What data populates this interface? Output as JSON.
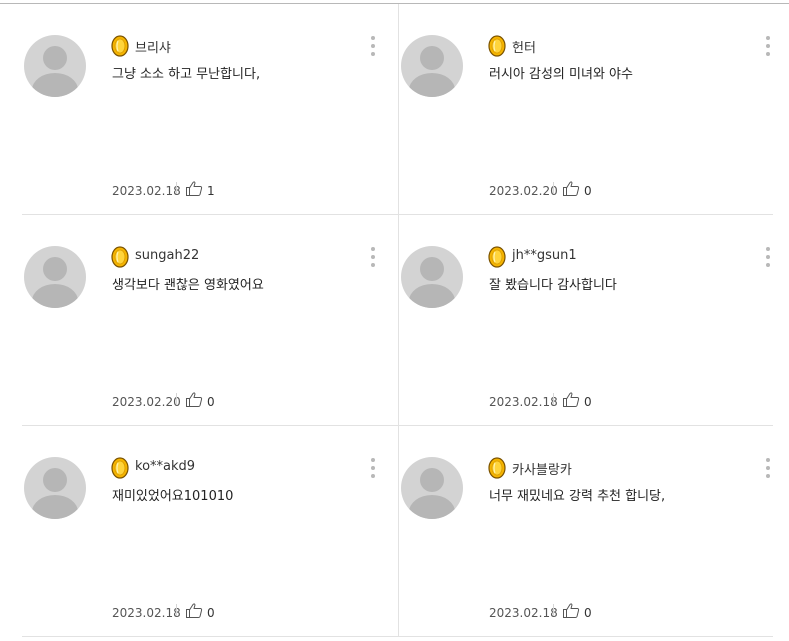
{
  "reviews": [
    {
      "nick": "브리샤",
      "comment": "그냥 소소 하고 무난합니다,",
      "date": "2023.02.18",
      "likes": "1"
    },
    {
      "nick": "헌터",
      "comment": "러시아 감성의 미녀와 야수",
      "date": "2023.02.20",
      "likes": "0"
    },
    {
      "nick": "sungah22",
      "comment": "생각보다 괜찮은 영화였어요",
      "date": "2023.02.20",
      "likes": "0"
    },
    {
      "nick": "jh**gsun1",
      "comment": "잘 봤습니다 감사합니다",
      "date": "2023.02.18",
      "likes": "0"
    },
    {
      "nick": "ko**akd9",
      "comment": "재미있었어요101010",
      "date": "2023.02.18",
      "likes": "0"
    },
    {
      "nick": "카사블랑카",
      "comment": "너무 재밌네요 강력 추천 합니당,",
      "date": "2023.02.18",
      "likes": "0"
    }
  ],
  "colors": {
    "badge": "#F5B400",
    "badge_outline": "#7A5200",
    "divider": "#E2E2E2"
  },
  "icons": {
    "badge": "gold-badge-icon",
    "more": "more-vertical-icon",
    "like": "thumbs-up-icon",
    "avatar": "default-avatar-icon"
  }
}
